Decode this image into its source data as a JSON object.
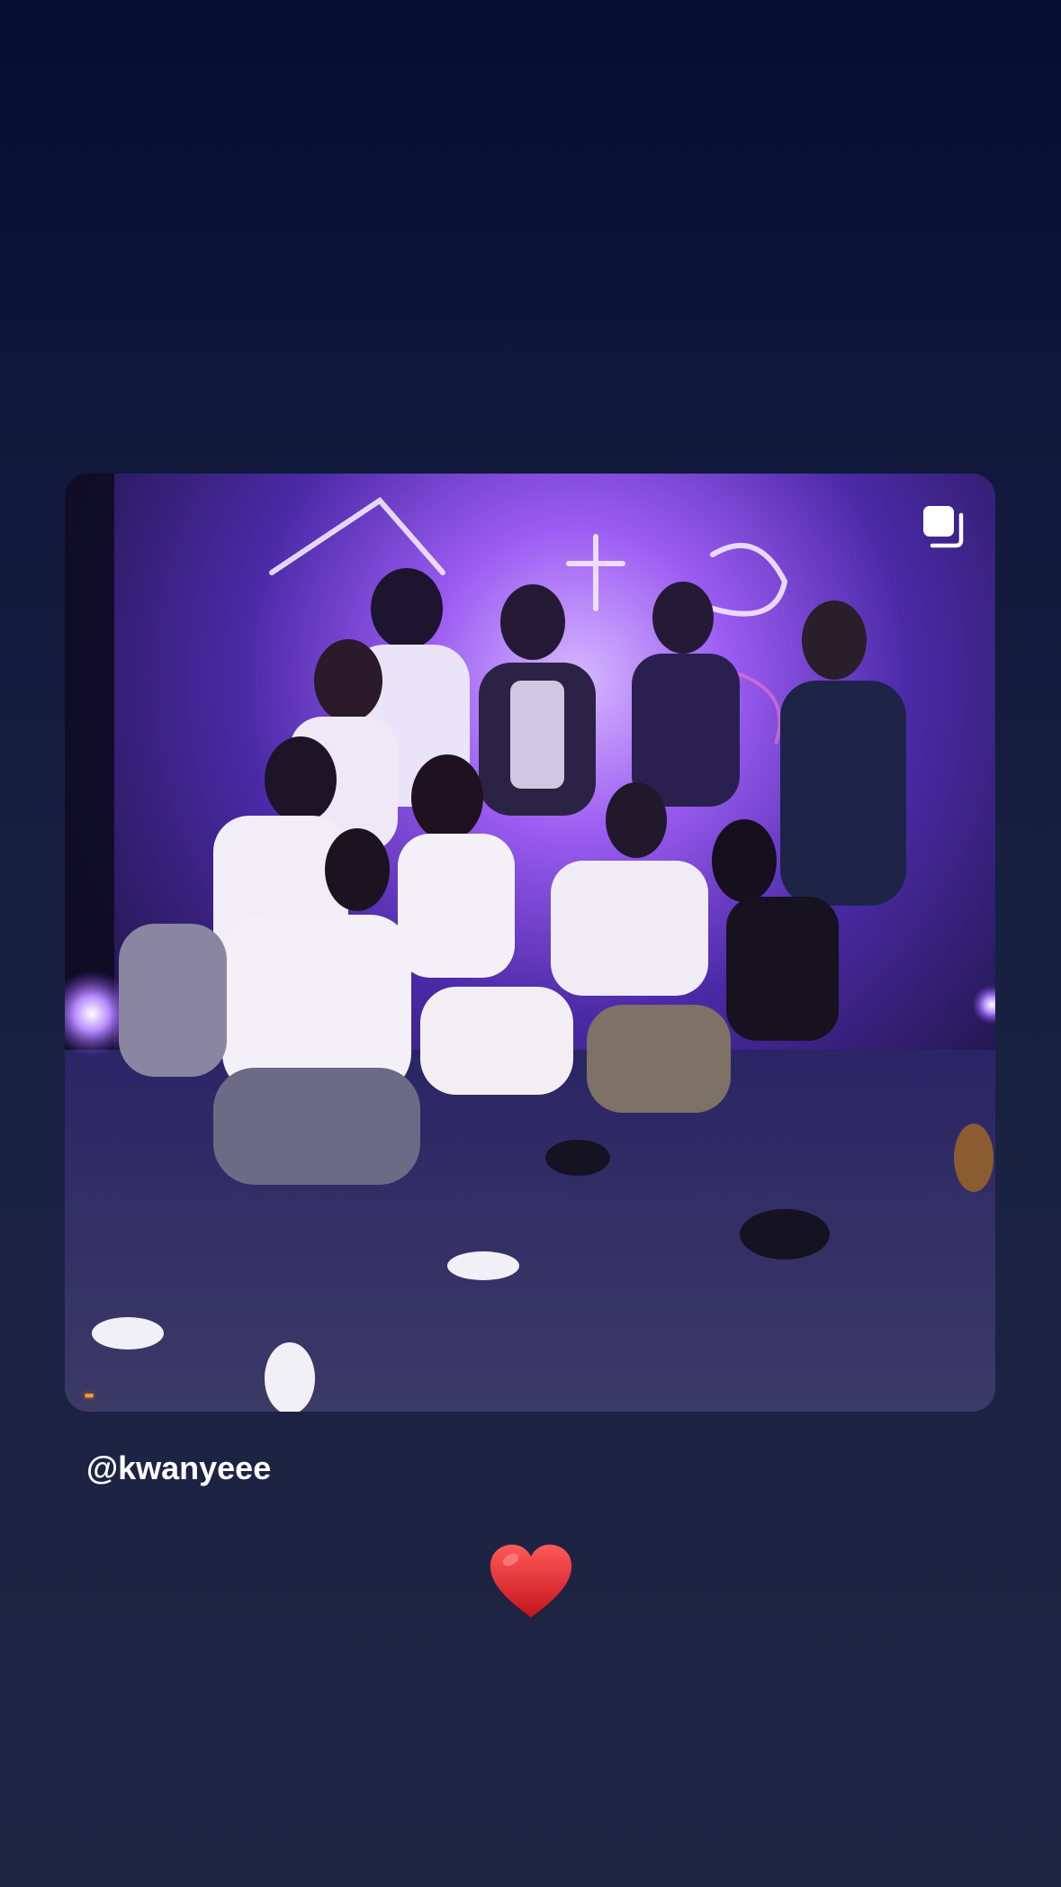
{
  "story": {
    "mention": "@kwanyeee",
    "date_stamp": "'25 0",
    "reaction_icon": "red-heart-icon",
    "media_badge_icon": "multiple-images-icon"
  },
  "colors": {
    "background_top": "#050d33",
    "background_bottom": "#1f2443",
    "neon": "#b98cff",
    "heart": "#e3262b",
    "date_stamp": "#ff9a2a"
  }
}
